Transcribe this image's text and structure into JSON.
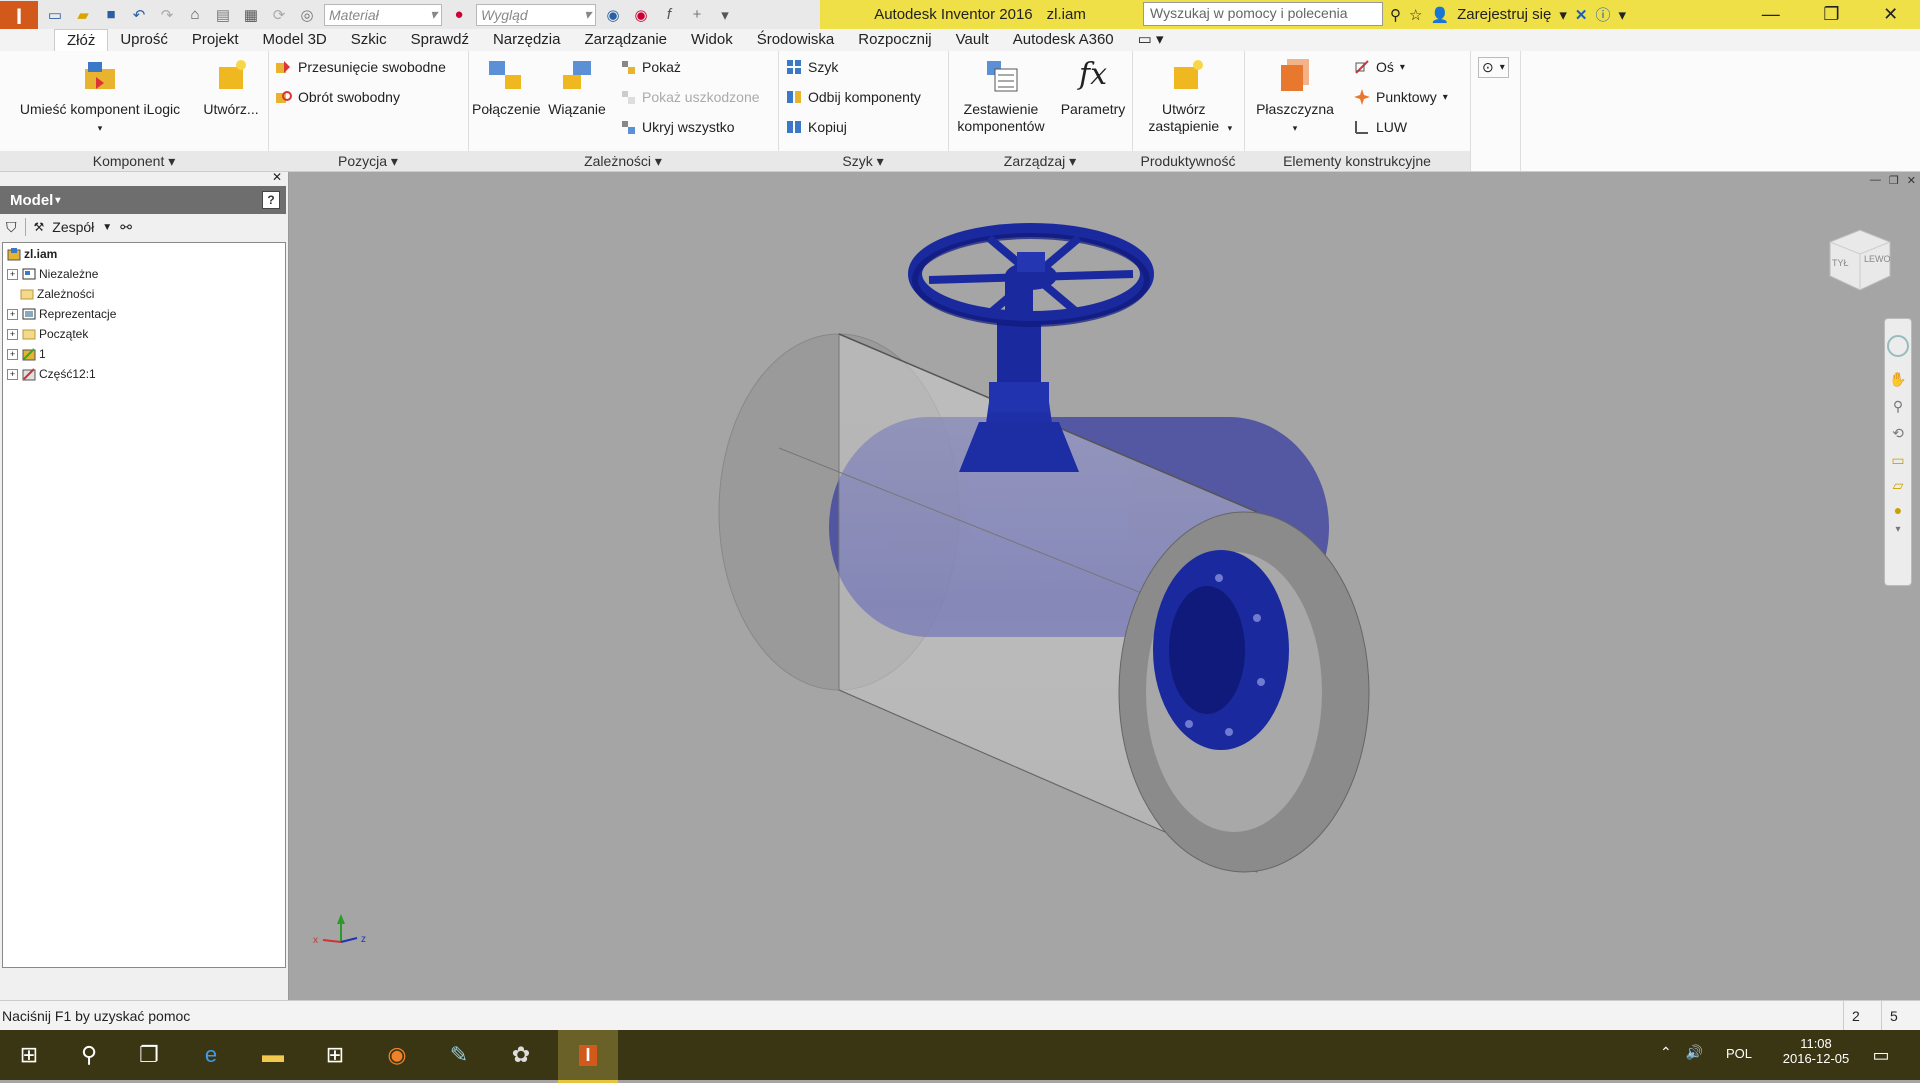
{
  "app": {
    "title": "Autodesk Inventor 2016",
    "document": "zl.iam",
    "material_placeholder": "Materiał",
    "appearance_placeholder": "Wygląd",
    "help_search_placeholder": "Wyszukaj w pomocy i polecenia",
    "sign_in_label": "Zarejestruj się"
  },
  "tabs": [
    "Złóż",
    "Uprość",
    "Projekt",
    "Model 3D",
    "Szkic",
    "Sprawdź",
    "Narzędzia",
    "Zarządzanie",
    "Widok",
    "Środowiska",
    "Rozpocznij",
    "Vault",
    "Autodesk A360"
  ],
  "ribbon": {
    "komponent": {
      "title": "Komponent",
      "place_ilogic": "Umieść komponent iLogic",
      "create": "Utwórz..."
    },
    "pozycja": {
      "title": "Pozycja",
      "free_move": "Przesunięcie swobodne",
      "free_rotate": "Obrót swobodny"
    },
    "zaleznosci": {
      "title": "Zależności",
      "joint": "Połączenie",
      "constrain": "Wiązanie",
      "show": "Pokaż",
      "show_sick": "Pokaż uszkodzone",
      "hide_all": "Ukryj wszystko"
    },
    "szyk": {
      "title": "Szyk",
      "pattern": "Szyk",
      "mirror": "Odbij komponenty",
      "copy": "Kopiuj"
    },
    "zarzadzaj": {
      "title": "Zarządzaj",
      "bom": "Zestawienie komponentów",
      "params": "Parametry"
    },
    "produktywnosc": {
      "title": "Produktywność",
      "substitute": "Utwórz zastąpienie"
    },
    "elementy": {
      "title": "Elementy konstrukcyjne",
      "plane": "Płaszczyzna",
      "axis": "Oś",
      "point": "Punktowy",
      "ucs": "LUW"
    }
  },
  "browser": {
    "title": "Model",
    "filter_label": "Zespół",
    "tree": [
      {
        "label": "zl.iam",
        "root": true
      },
      {
        "label": "Niezależne",
        "expandable": true
      },
      {
        "label": "Zależności",
        "expandable": false
      },
      {
        "label": "Reprezentacje",
        "expandable": true
      },
      {
        "label": "Początek",
        "expandable": true
      },
      {
        "label": "1",
        "expandable": true
      },
      {
        "label": "Część12:1",
        "expandable": true
      }
    ]
  },
  "viewcube": {
    "left": "TYŁ",
    "right": "LEWO"
  },
  "status": {
    "message": "Naciśnij F1 by uzyskać pomoc",
    "count1": "2",
    "count2": "5"
  },
  "taskbar": {
    "language": "POL",
    "time": "11:08",
    "date": "2016-12-05"
  },
  "colors": {
    "title_bar": "#f0e048",
    "valve_blue": "#1a2a9e",
    "viewport_bg": "#a5a5a5",
    "taskbar": "#3a3512"
  }
}
